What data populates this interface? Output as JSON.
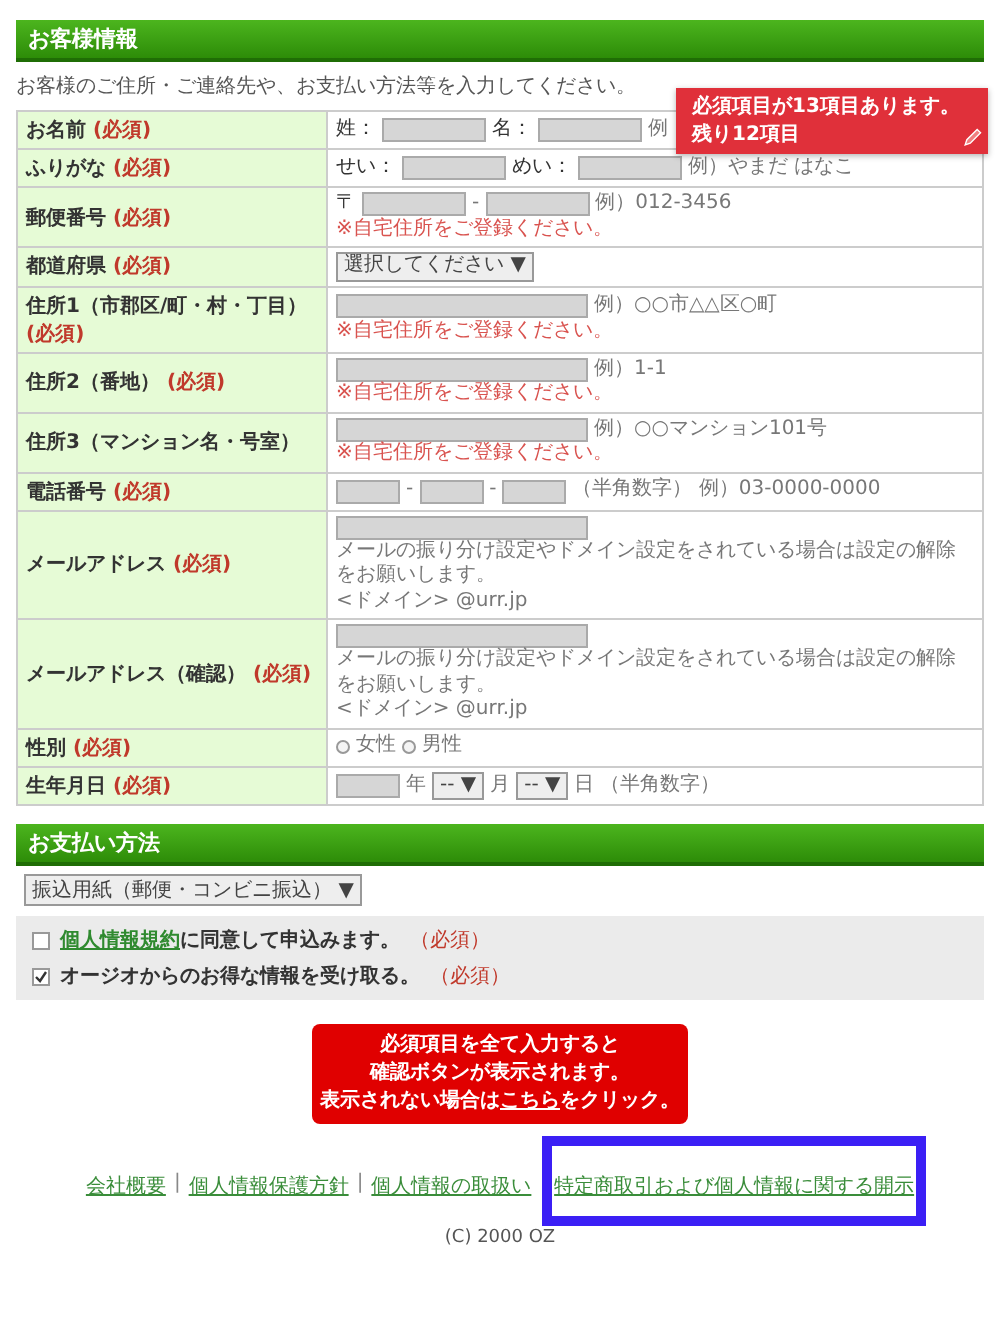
{
  "customer_section": {
    "title": "お客様情報",
    "intro": "お客様のご住所・ご連絡先や、お支払い方法等を入力してください。",
    "rows": [
      {
        "label": "お名前",
        "required": "(必須)",
        "lines": [
          [
            {
              "kind": "text",
              "text": "姓："
            },
            {
              "kind": "input"
            },
            {
              "kind": "text",
              "text": "名："
            },
            {
              "kind": "input"
            },
            {
              "kind": "hint",
              "text": "例"
            }
          ]
        ]
      },
      {
        "label": "ふりがな",
        "required": "(必須)",
        "lines": [
          [
            {
              "kind": "text",
              "text": "せい："
            },
            {
              "kind": "input"
            },
            {
              "kind": "text",
              "text": "めい："
            },
            {
              "kind": "input"
            },
            {
              "kind": "hint",
              "text": "例）やまだ はなこ"
            }
          ]
        ]
      },
      {
        "label": "郵便番号",
        "required": "(必須)",
        "lines": [
          [
            {
              "kind": "text",
              "text": "〒"
            },
            {
              "kind": "input"
            },
            {
              "kind": "hint",
              "text": "-"
            },
            {
              "kind": "input"
            },
            {
              "kind": "hint",
              "text": "例）012-3456"
            }
          ],
          [
            {
              "kind": "note",
              "text": "※自宅住所をご登録ください。"
            }
          ]
        ]
      },
      {
        "label": "都道府県",
        "required": "(必須)",
        "lines": [
          [
            {
              "kind": "select",
              "value": "選択してください",
              "arrow": "▼"
            }
          ]
        ]
      },
      {
        "label": "住所1（市郡区/町・村・丁目）",
        "required": "(必須)",
        "lines": [
          [
            {
              "kind": "input"
            },
            {
              "kind": "hint",
              "text": "例）○○市△△区○町"
            }
          ],
          [
            {
              "kind": "note",
              "text": "※自宅住所をご登録ください。"
            }
          ]
        ]
      },
      {
        "label": "住所2（番地）",
        "required": "(必須)",
        "lines": [
          [
            {
              "kind": "input"
            },
            {
              "kind": "hint",
              "text": "例）1-1"
            }
          ],
          [
            {
              "kind": "note",
              "text": "※自宅住所をご登録ください。"
            }
          ]
        ]
      },
      {
        "label": "住所3（マンション名・号室）",
        "lines": [
          [
            {
              "kind": "input"
            },
            {
              "kind": "hint",
              "text": "例）○○マンション101号"
            }
          ],
          [
            {
              "kind": "note",
              "text": "※自宅住所をご登録ください。"
            }
          ]
        ]
      },
      {
        "label": "電話番号",
        "required": "(必須)",
        "lines": [
          [
            {
              "kind": "input"
            },
            {
              "kind": "hint",
              "text": "-"
            },
            {
              "kind": "input"
            },
            {
              "kind": "hint",
              "text": "-"
            },
            {
              "kind": "input"
            },
            {
              "kind": "hint",
              "text": "（半角数字） 例）03-0000-0000"
            }
          ]
        ]
      },
      {
        "label": "メールアドレス",
        "required": "(必須)",
        "lines": [
          [
            {
              "kind": "input"
            }
          ],
          [
            {
              "kind": "hint",
              "text": "メールの振り分け設定やドメイン設定をされている場合は設定の解除をお願いします。"
            }
          ],
          [
            {
              "kind": "hint",
              "text": "<ドメイン> @urr.jp"
            }
          ]
        ]
      },
      {
        "label": "メールアドレス（確認）",
        "required": "(必須)",
        "lines": [
          [
            {
              "kind": "input"
            }
          ],
          [
            {
              "kind": "hint",
              "text": "メールの振り分け設定やドメイン設定をされている場合は設定の解除をお願いします。"
            }
          ],
          [
            {
              "kind": "hint",
              "text": "<ドメイン> @urr.jp"
            }
          ]
        ]
      },
      {
        "label": "性別",
        "required": "(必須)",
        "lines": [
          [
            {
              "kind": "radio",
              "text": "女性",
              "selected": false
            },
            {
              "kind": "radio",
              "text": "男性",
              "selected": false
            }
          ]
        ]
      },
      {
        "label": "生年月日",
        "required": "(必須)",
        "lines": [
          [
            {
              "kind": "input"
            },
            {
              "kind": "hint",
              "text": "年"
            },
            {
              "kind": "select",
              "value": "--",
              "arrow": "▼"
            },
            {
              "kind": "hint",
              "text": "月"
            },
            {
              "kind": "select",
              "value": "--",
              "arrow": "▼"
            },
            {
              "kind": "hint",
              "text": "日"
            },
            {
              "kind": "hint",
              "text": "（半角数字）"
            }
          ]
        ]
      }
    ]
  },
  "tooltip": {
    "lines": [
      "必須項目が13項目あります。",
      "残り12項目"
    ]
  },
  "payment_section": {
    "title": "お支払い方法",
    "select": "振込用紙（郵便・コンビニ振込）",
    "arrow": "▼",
    "agreements": [
      {
        "link": "個人情報規約",
        "text": "に同意して申込みます。",
        "required": "（必須）",
        "checked": false
      },
      {
        "text": "オージオからのお得な情報を受け取る。",
        "required": "（必須）",
        "checked": true
      }
    ]
  },
  "notice": {
    "lines": [
      "必須項目を全て入力すると",
      "確認ボタンが表示されます。"
    ],
    "before": "表示されない場合は",
    "link": "こちら",
    "after": "をクリック。"
  },
  "footer": {
    "links": [
      "会社概要",
      "個人情報保護方針",
      "個人情報の取扱い",
      "特定商取引および個人情報に関する開示"
    ],
    "separator": "|",
    "copyright": "(C) 2000 OZ"
  }
}
